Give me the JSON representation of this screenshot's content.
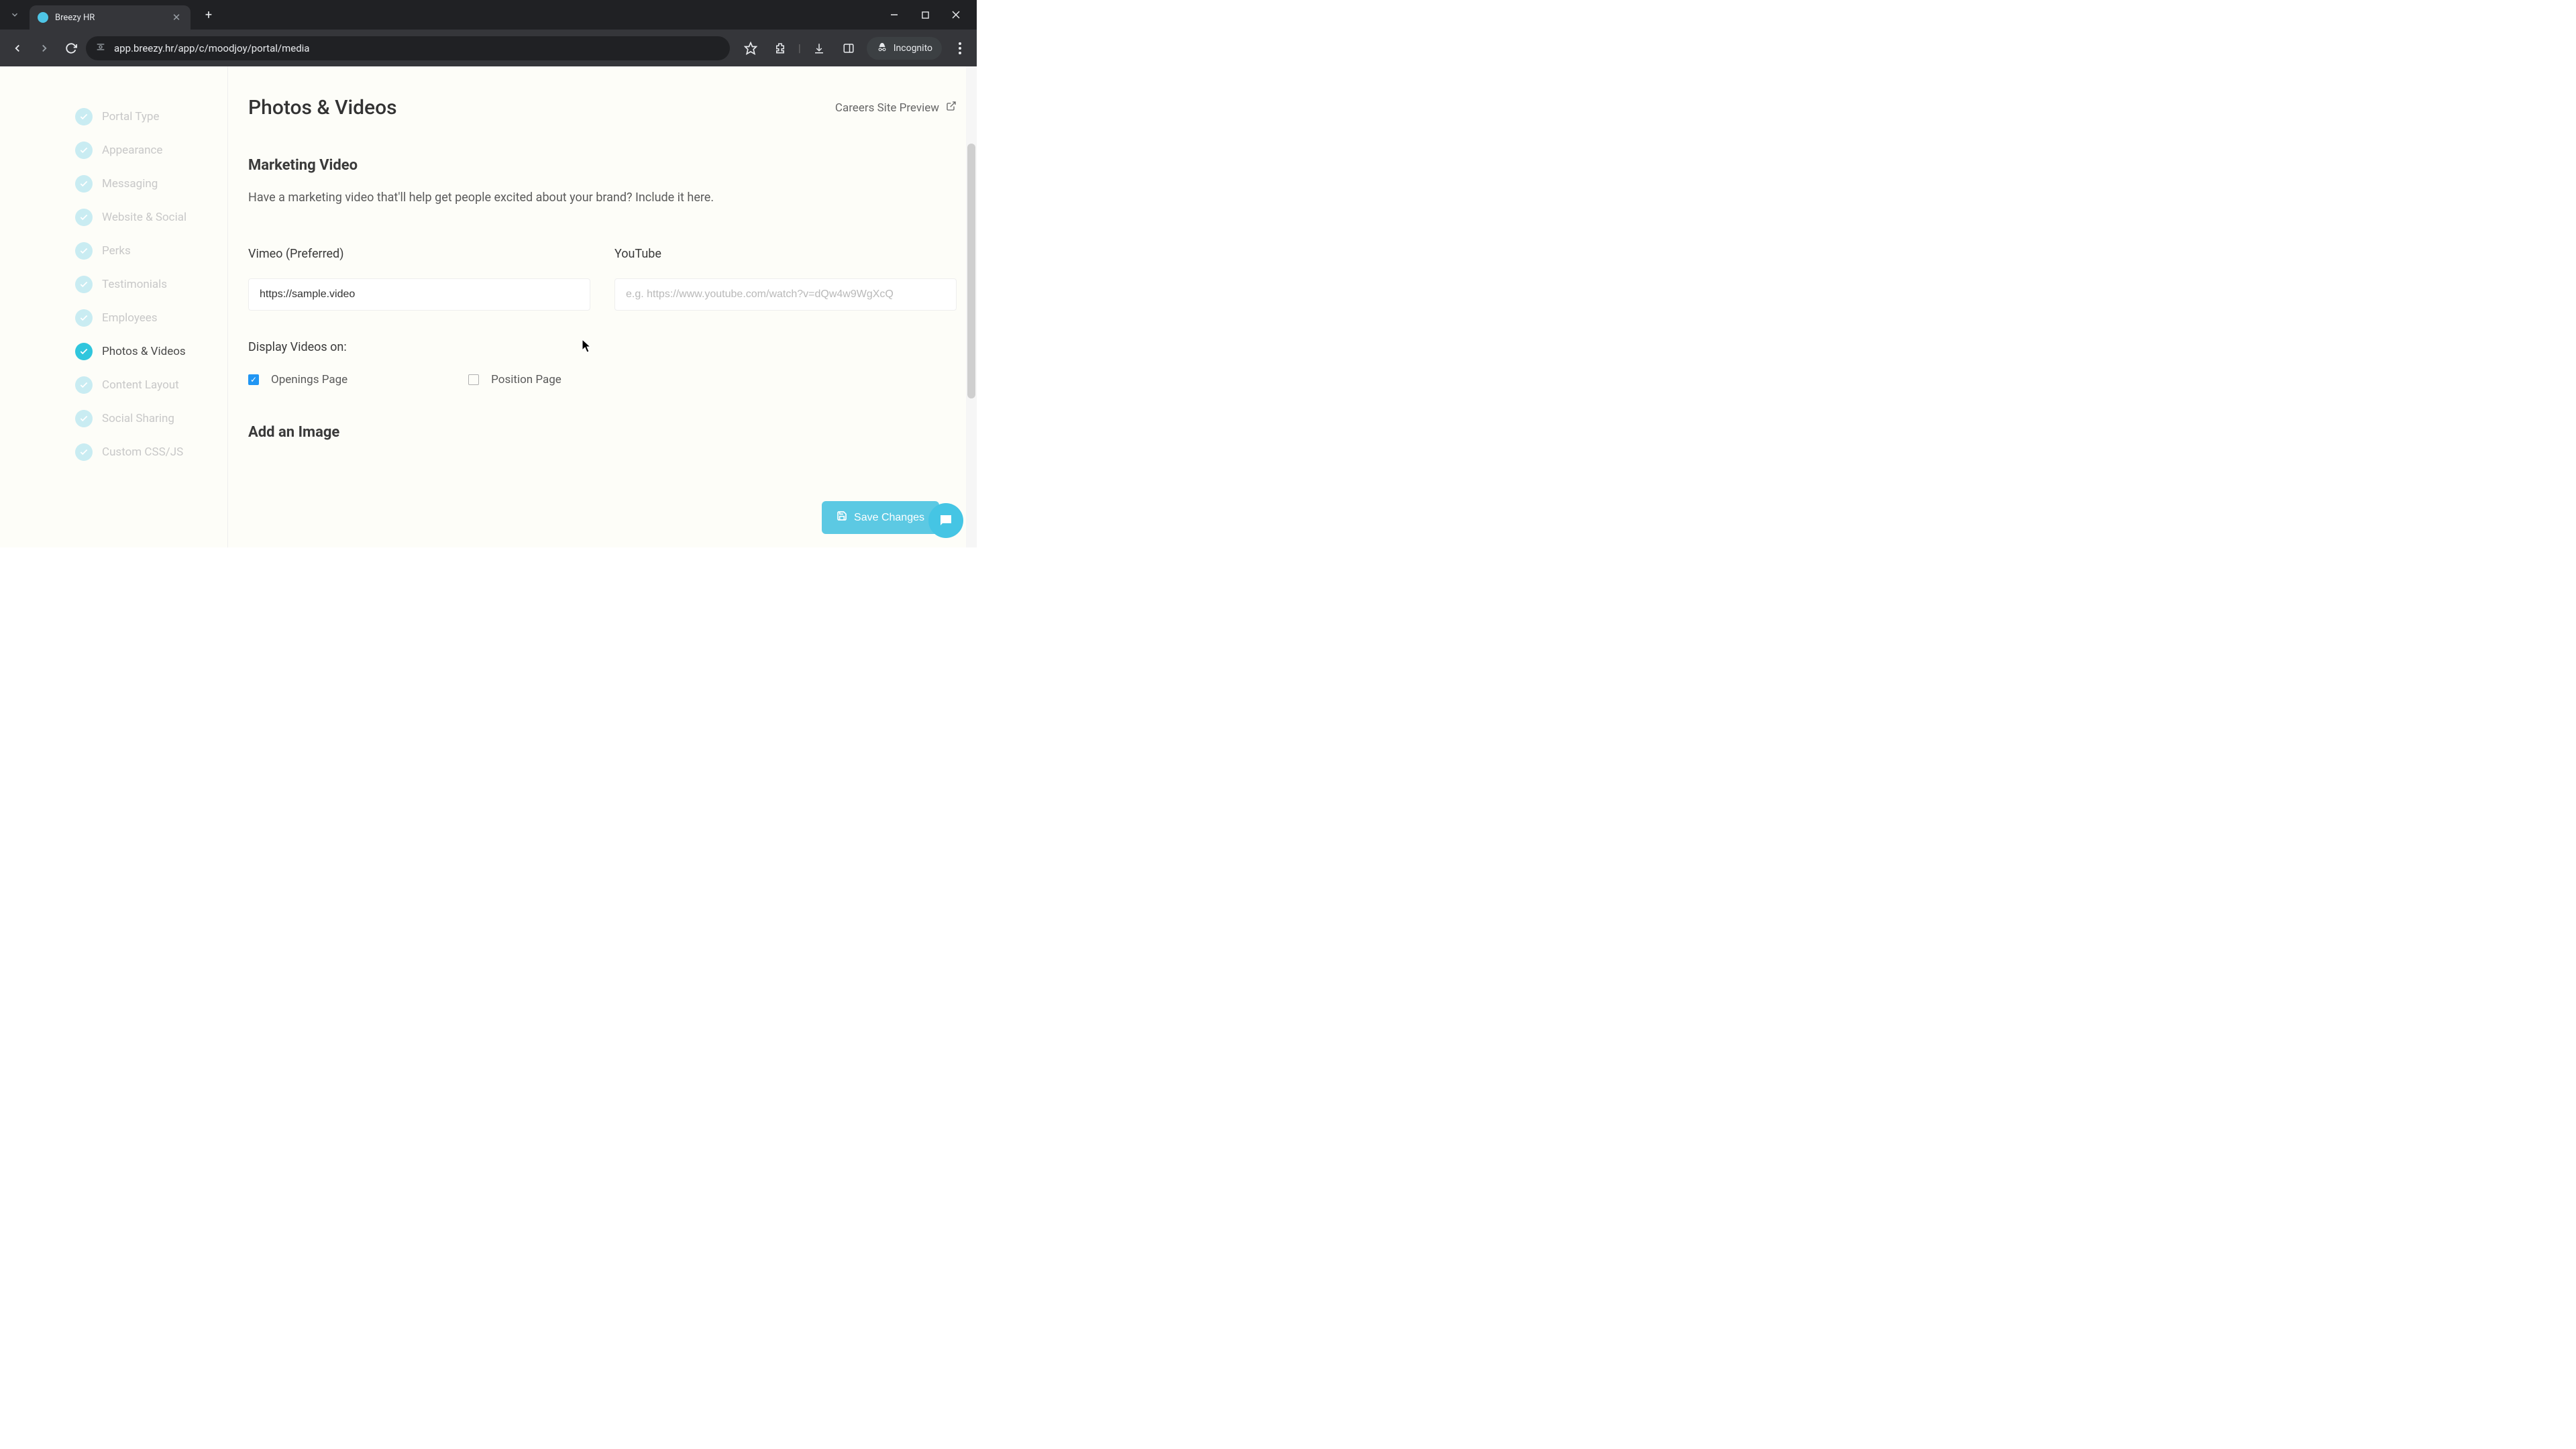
{
  "browser": {
    "tab_title": "Breezy HR",
    "url": "app.breezy.hr/app/c/moodjoy/portal/media",
    "incognito_label": "Incognito"
  },
  "sidebar": {
    "items": [
      {
        "label": "Portal Type",
        "active": false
      },
      {
        "label": "Appearance",
        "active": false
      },
      {
        "label": "Messaging",
        "active": false
      },
      {
        "label": "Website & Social",
        "active": false
      },
      {
        "label": "Perks",
        "active": false
      },
      {
        "label": "Testimonials",
        "active": false
      },
      {
        "label": "Employees",
        "active": false
      },
      {
        "label": "Photos & Videos",
        "active": true
      },
      {
        "label": "Content Layout",
        "active": false
      },
      {
        "label": "Social Sharing",
        "active": false
      },
      {
        "label": "Custom CSS/JS",
        "active": false
      }
    ]
  },
  "page": {
    "title": "Photos & Videos",
    "preview_link": "Careers Site Preview",
    "marketing_title": "Marketing Video",
    "marketing_desc": "Have a marketing video that'll help get people excited about your brand? Include it here.",
    "vimeo_label": "Vimeo (Preferred)",
    "vimeo_value": "https://sample.video",
    "youtube_label": "YouTube",
    "youtube_placeholder": "e.g. https://www.youtube.com/watch?v=dQw4w9WgXcQ",
    "display_label": "Display Videos on:",
    "checkboxes": [
      {
        "label": "Openings Page",
        "checked": true
      },
      {
        "label": "Position Page",
        "checked": false
      }
    ],
    "add_image_title": "Add an Image",
    "save_button": "Save Changes"
  }
}
